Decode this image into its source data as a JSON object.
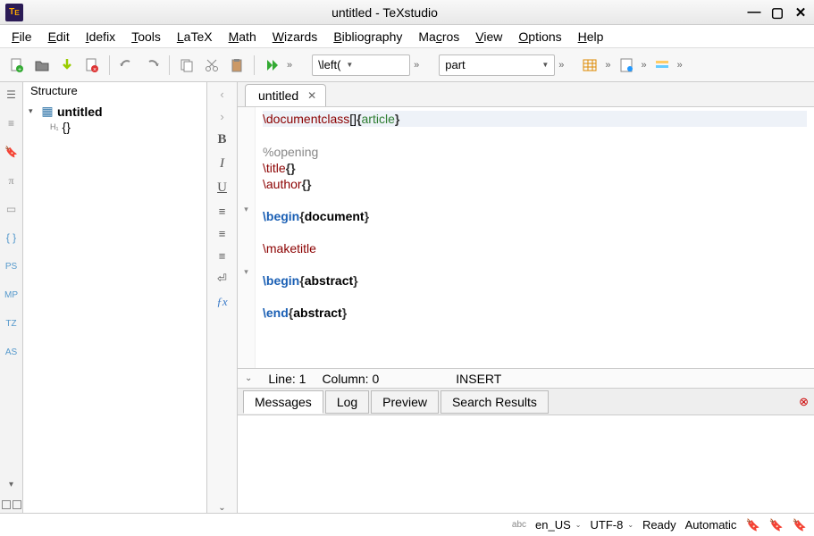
{
  "titlebar": {
    "title": "untitled - TeXstudio"
  },
  "menu": [
    "File",
    "Edit",
    "Idefix",
    "Tools",
    "LaTeX",
    "Math",
    "Wizards",
    "Bibliography",
    "Macros",
    "View",
    "Options",
    "Help"
  ],
  "toolbar": {
    "combo1": "\\left(",
    "combo2": "part"
  },
  "structure": {
    "header": "Structure",
    "root": "untitled",
    "child": "{}"
  },
  "tab": {
    "label": "untitled"
  },
  "code_lines": [
    {
      "fold": "",
      "segs": [
        {
          "t": "\\documentclass",
          "c": "cmd2"
        },
        {
          "t": "[]",
          "c": ""
        },
        {
          "t": "{",
          "c": "br"
        },
        {
          "t": "article",
          "c": "arg"
        },
        {
          "t": "}",
          "c": "br"
        }
      ],
      "hl": true
    },
    {
      "fold": "",
      "segs": []
    },
    {
      "fold": "",
      "segs": [
        {
          "t": "%opening",
          "c": "cm"
        }
      ]
    },
    {
      "fold": "",
      "segs": [
        {
          "t": "\\title",
          "c": "cmd2"
        },
        {
          "t": "{}",
          "c": "br"
        }
      ]
    },
    {
      "fold": "",
      "segs": [
        {
          "t": "\\author",
          "c": "cmd2"
        },
        {
          "t": "{}",
          "c": "br"
        }
      ]
    },
    {
      "fold": "",
      "segs": []
    },
    {
      "fold": "▾",
      "segs": [
        {
          "t": "\\begin",
          "c": "cmd"
        },
        {
          "t": "{",
          "c": "br"
        },
        {
          "t": "document",
          "c": "kw"
        },
        {
          "t": "}",
          "c": "br"
        }
      ]
    },
    {
      "fold": "",
      "segs": []
    },
    {
      "fold": "",
      "segs": [
        {
          "t": "\\maketitle",
          "c": "cmd2"
        }
      ]
    },
    {
      "fold": "",
      "segs": []
    },
    {
      "fold": "▾",
      "segs": [
        {
          "t": "\\begin",
          "c": "cmd"
        },
        {
          "t": "{",
          "c": "br"
        },
        {
          "t": "abstract",
          "c": "kw"
        },
        {
          "t": "}",
          "c": "br"
        }
      ]
    },
    {
      "fold": "",
      "segs": []
    },
    {
      "fold": "",
      "segs": [
        {
          "t": "\\end",
          "c": "cmd"
        },
        {
          "t": "{",
          "c": "br"
        },
        {
          "t": "abstract",
          "c": "kw"
        },
        {
          "t": "}",
          "c": "br"
        }
      ]
    }
  ],
  "status": {
    "line": "Line: 1",
    "col": "Column: 0",
    "mode": "INSERT"
  },
  "bottom_tabs": [
    "Messages",
    "Log",
    "Preview",
    "Search Results"
  ],
  "statusbar": {
    "spell": "abc",
    "lang": "en_US",
    "enc": "UTF-8",
    "state": "Ready",
    "auto": "Automatic"
  }
}
